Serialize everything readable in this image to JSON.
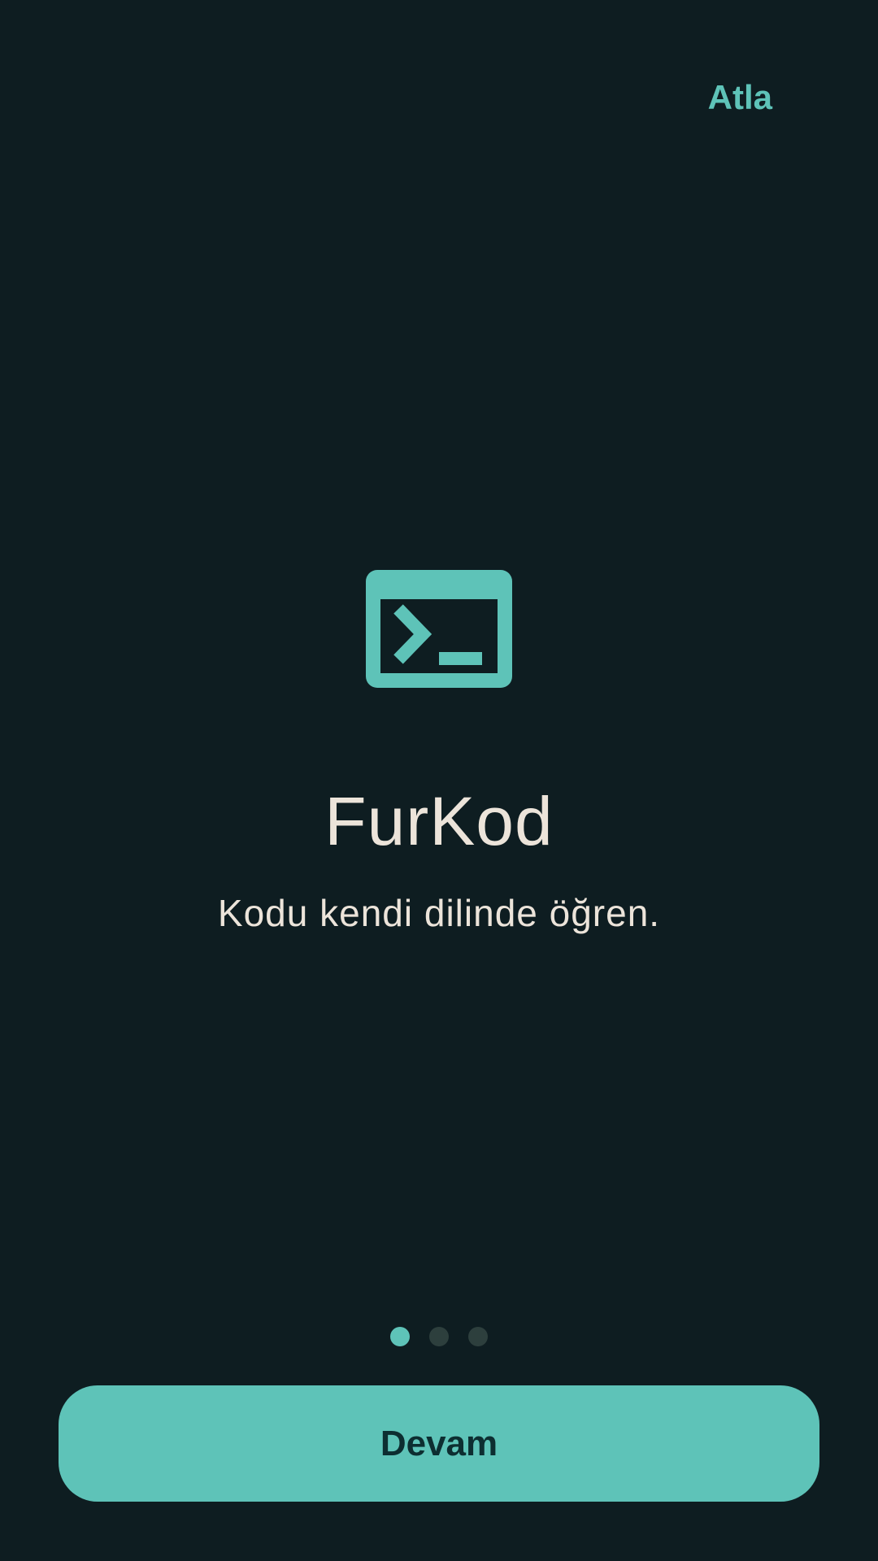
{
  "header": {
    "skip_label": "Atla"
  },
  "hero": {
    "icon": "terminal-icon",
    "title": "FurKod",
    "tagline": "Kodu kendi dilinde öğren."
  },
  "pager": {
    "total": 3,
    "current": 1
  },
  "footer": {
    "continue_label": "Devam"
  },
  "colors": {
    "background": "#0e1d21",
    "accent": "#5ec3b8",
    "text": "#ece4da",
    "dot_inactive": "#2d3f3d",
    "button_text": "#0d2e31"
  }
}
